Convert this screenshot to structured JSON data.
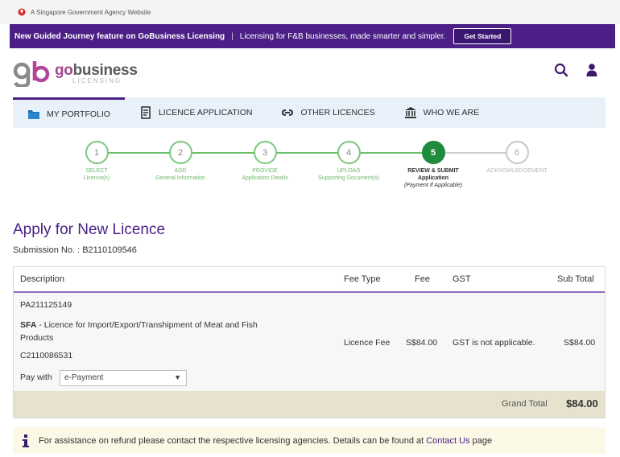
{
  "gov_bar": {
    "text": "A Singapore Government Agency Website"
  },
  "announcement": {
    "bold_text": "New Guided Journey feature on GoBusiness Licensing",
    "text": "Licensing for F&B businesses, made smarter and simpler.",
    "button": "Get Started"
  },
  "brand": {
    "name_prefix": "go",
    "name_main": "business",
    "sub": "LICENSING"
  },
  "nav": {
    "portfolio": "MY PORTFOLIO",
    "application": "LICENCE APPLICATION",
    "other": "OTHER LICENCES",
    "who": "WHO WE ARE"
  },
  "steps": [
    {
      "num": "1",
      "line1": "SELECT",
      "line2": "Licence(s)",
      "line3": ""
    },
    {
      "num": "2",
      "line1": "ADD",
      "line2": "General Information",
      "line3": ""
    },
    {
      "num": "3",
      "line1": "PROVIDE",
      "line2": "Application Details",
      "line3": ""
    },
    {
      "num": "4",
      "line1": "UPLOAD",
      "line2": "Supporting Document(s)",
      "line3": ""
    },
    {
      "num": "5",
      "line1": "REVIEW & SUBMIT",
      "line2": "Application",
      "line3": "(Payment If Applicable)"
    },
    {
      "num": "6",
      "line1": "ACKNOWLEDGEMENT",
      "line2": "",
      "line3": ""
    }
  ],
  "page": {
    "title": "Apply for New Licence",
    "submission_label": "Submission No. :",
    "submission_no": "B2110109546"
  },
  "table": {
    "headers": {
      "description": "Description",
      "fee_type": "Fee Type",
      "fee": "Fee",
      "gst": "GST",
      "sub_total": "Sub Total"
    },
    "row": {
      "ref": "PA211125149",
      "agency": "SFA",
      "desc_line1": " - Licence for Import/Export/Transhipment of Meat and Fish",
      "desc_line2": "Products",
      "code": "C2110086531",
      "pay_label": "Pay with",
      "pay_value": "e-Payment",
      "fee_type": "Licence Fee",
      "fee": "S$84.00",
      "gst": "GST is not applicable.",
      "sub_total": "S$84.00"
    },
    "grand_total_label": "Grand Total",
    "grand_total": "$84.00"
  },
  "info": {
    "text_before": "For assistance on refund please contact the respective licensing agencies. Details can be found at",
    "link": "Contact Us",
    "text_after": "page"
  },
  "colors": {
    "primary": "#4b1f86",
    "success": "#1f8b3c",
    "step_green": "#6bbf6b"
  }
}
